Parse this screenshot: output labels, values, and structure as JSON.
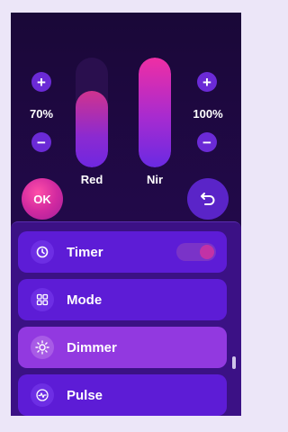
{
  "left_control": {
    "percent": "70%",
    "level": 0.7
  },
  "right_control": {
    "percent": "100%",
    "level": 1.0
  },
  "sliders": [
    {
      "label": "Red",
      "level": 0.7
    },
    {
      "label": "Nir",
      "level": 1.0
    }
  ],
  "buttons": {
    "ok_label": "OK",
    "plus": "+",
    "minus": "−"
  },
  "menu": {
    "items": [
      {
        "label": "Timer",
        "icon": "clock-icon",
        "toggle": "on"
      },
      {
        "label": "Mode",
        "icon": "grid-icon"
      },
      {
        "label": "Dimmer",
        "icon": "sun-icon",
        "active": true
      },
      {
        "label": "Pulse",
        "icon": "pulse-icon"
      }
    ]
  },
  "colors": {
    "background": "#1c0a3c",
    "accent": "#6b2ad6",
    "ok_button": "#d22aa0",
    "menu_active": "#9239e0"
  }
}
